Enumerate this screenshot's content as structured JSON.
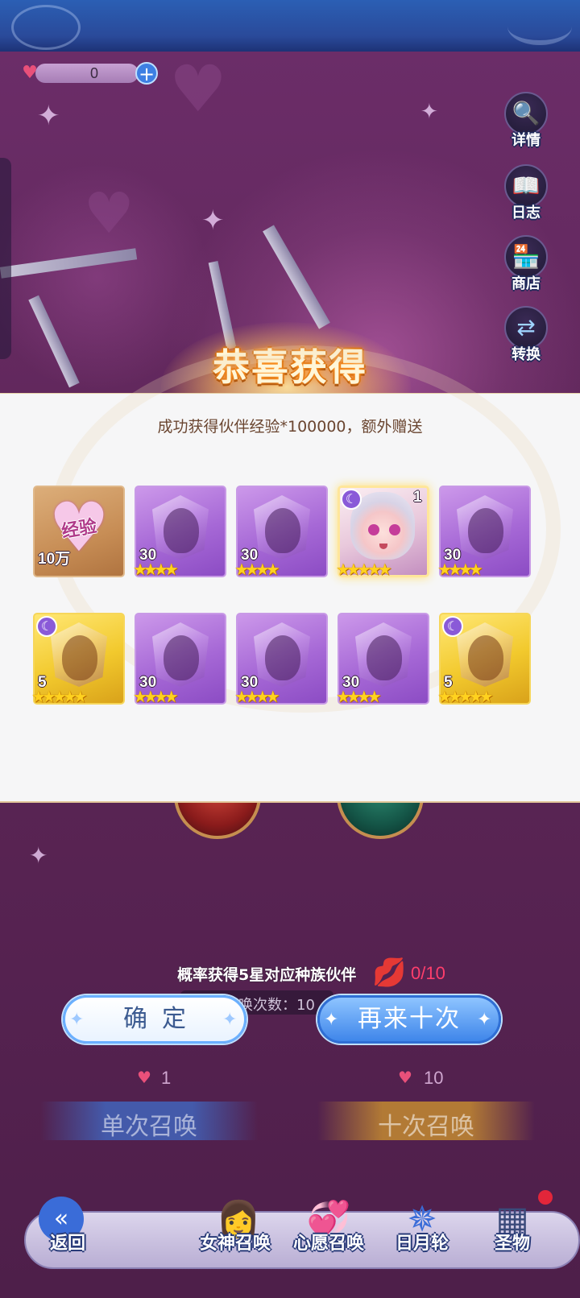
{
  "currency": {
    "value": "0",
    "plus": "+"
  },
  "side_buttons": [
    {
      "label": "详情",
      "icon": "magnifier-icon",
      "glyph": "🔍"
    },
    {
      "label": "日志",
      "icon": "book-icon",
      "glyph": "📖"
    },
    {
      "label": "商店",
      "icon": "shop-icon",
      "glyph": "🏪"
    },
    {
      "label": "转换",
      "icon": "swap-icon",
      "glyph": "⇄"
    }
  ],
  "dialog": {
    "title": "恭喜获得",
    "subtitle": "成功获得伙伴经验*100000，额外赠送",
    "items": [
      {
        "kind": "exp",
        "label": "经验",
        "count": "10万",
        "stars": 0
      },
      {
        "kind": "purple",
        "count": "30",
        "stars": 4
      },
      {
        "kind": "purple",
        "count": "30",
        "stars": 4
      },
      {
        "kind": "hero",
        "count": "1",
        "stars": 5
      },
      {
        "kind": "purple",
        "count": "30",
        "stars": 4
      },
      {
        "kind": "gold",
        "count": "5",
        "stars": 5
      },
      {
        "kind": "purple",
        "count": "30",
        "stars": 4
      },
      {
        "kind": "purple",
        "count": "30",
        "stars": 4
      },
      {
        "kind": "purple",
        "count": "30",
        "stars": 4
      },
      {
        "kind": "gold",
        "count": "5",
        "stars": 5
      }
    ]
  },
  "chance_text": "概率获得5星对应种族伙伴",
  "wish_counter": "0/10",
  "times_text": "唤次数：10",
  "buttons": {
    "confirm": "确定",
    "again": "再来十次"
  },
  "summon": {
    "single": {
      "cost": "1",
      "label": "单次召唤"
    },
    "ten": {
      "cost": "10",
      "label": "十次召唤"
    }
  },
  "nav": [
    {
      "label": "返回",
      "icon": "back-arrow-icon",
      "glyph": "«"
    },
    {
      "label": "女神召唤",
      "icon": "goddess-portrait-icon",
      "glyph": "👩"
    },
    {
      "label": "心愿召唤",
      "icon": "hearts-icon",
      "glyph": "💞"
    },
    {
      "label": "日月轮",
      "icon": "sun-moon-wheel-icon",
      "glyph": "✵"
    },
    {
      "label": "圣物",
      "icon": "relic-chest-icon",
      "glyph": "▦"
    }
  ],
  "colors": {
    "accent_blue": "#3f86ea",
    "panel_bg": "#f6f6f7",
    "wish_red": "#ff3e6c",
    "star_gold": "#ffd21f"
  }
}
